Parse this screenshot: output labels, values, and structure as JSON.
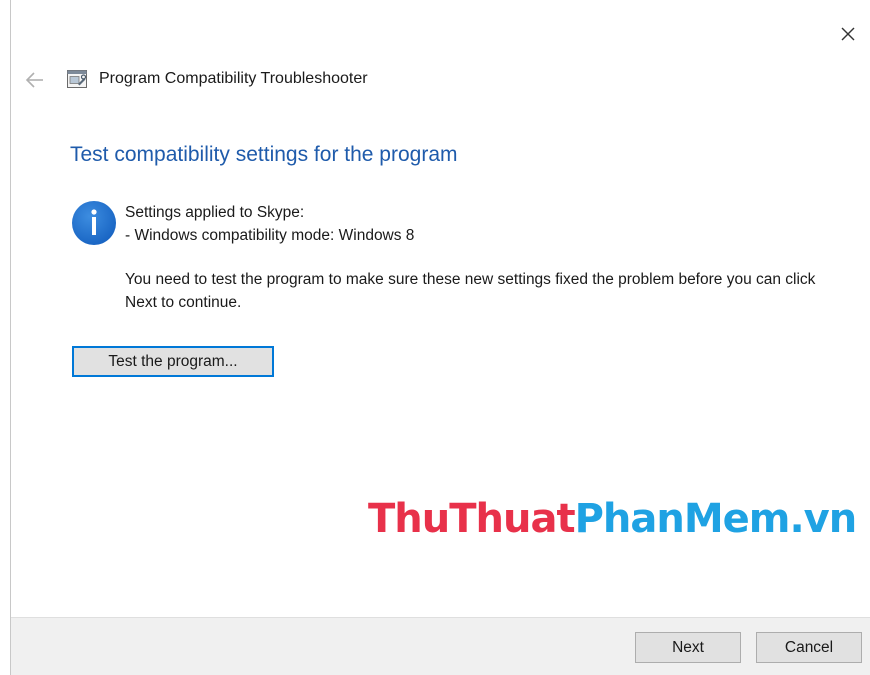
{
  "window": {
    "title": "Program Compatibility Troubleshooter"
  },
  "icons": {
    "close": "close-icon",
    "back": "back-arrow-icon",
    "app": "troubleshooter-app-icon",
    "info": "info-icon"
  },
  "main": {
    "heading": "Test compatibility settings for the program",
    "settings_line1": "Settings applied to Skype:",
    "settings_line2": "- Windows compatibility mode: Windows 8",
    "message": "You need to test the program to make sure these new settings fixed the problem before you can click Next to continue.",
    "test_button_label": "Test the program..."
  },
  "watermark": {
    "part1": "ThuThuat",
    "part2": "PhanMem.vn"
  },
  "footer": {
    "next_label": "Next",
    "cancel_label": "Cancel"
  },
  "colors": {
    "heading": "#1f5bab",
    "accent": "#0078d7",
    "watermark_red": "#e8314a",
    "watermark_blue": "#1fa2e3"
  }
}
